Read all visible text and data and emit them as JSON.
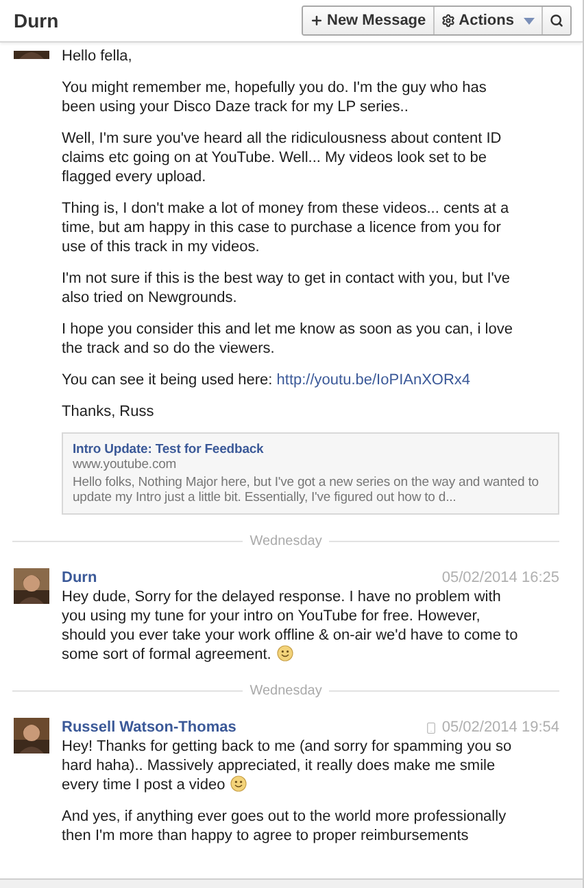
{
  "header": {
    "title": "Durn",
    "buttons": [
      {
        "kind": "new",
        "label": "New Message"
      },
      {
        "kind": "actions",
        "label": "Actions"
      },
      {
        "kind": "search"
      }
    ]
  },
  "thread": [
    {
      "kind": "message",
      "cut": true,
      "paragraphs": [
        {
          "text": "Hello fella,"
        },
        {
          "text": "You might remember me, hopefully you do. I'm the guy who has been using your Disco Daze track for my LP series.."
        },
        {
          "text": "Well, I'm sure you've heard all the ridiculousness about content ID claims etc going on at YouTube. Well... My videos look set to be flagged every upload."
        },
        {
          "text": "Thing is, I don't make a lot of money from these videos... cents at a time, but am happy in this case to purchase a licence from you for use of this track in my videos."
        },
        {
          "text": "I'm not sure if this is the best way to get in contact with you, but I've also tried on Newgrounds."
        },
        {
          "text": "I hope you consider this and let me know as soon as you can, i love the track and so do the viewers."
        },
        {
          "text": "You can see it being used here: ",
          "link": "http://youtu.be/IoPIAnXORx4"
        },
        {
          "text": "Thanks, Russ"
        }
      ],
      "preview": {
        "title": "Intro Update: Test for Feedback",
        "site": "www.youtube.com",
        "excerpt": "Hello folks, Nothing Major here, but I've got a new series on the way and wanted to update my Intro just a little bit. Essentially, I've figured out how to d..."
      }
    },
    {
      "kind": "divider",
      "label": "Wednesday"
    },
    {
      "kind": "message",
      "name": "Durn",
      "time": "05/02/2014 16:25",
      "mobile": false,
      "paragraphs": [
        {
          "text": "Hey dude, Sorry for the delayed response. I have no problem with you using my tune for your intro on YouTube for free. However, should you ever take your work offline & on-air we'd have to come to some sort of formal agreement.",
          "smiley": true
        }
      ]
    },
    {
      "kind": "divider",
      "label": "Wednesday"
    },
    {
      "kind": "message",
      "name": "Russell Watson-Thomas",
      "time": "05/02/2014 19:54",
      "mobile": true,
      "paragraphs": [
        {
          "text": "Hey! Thanks for getting back to me (and sorry for spamming you so hard haha).. Massively appreciated, it really does make me smile every time I post a video",
          "smiley": true
        },
        {
          "text": "And yes, if anything ever goes out to the world more professionally then I'm more than happy to agree to proper reimbursements"
        }
      ]
    }
  ]
}
